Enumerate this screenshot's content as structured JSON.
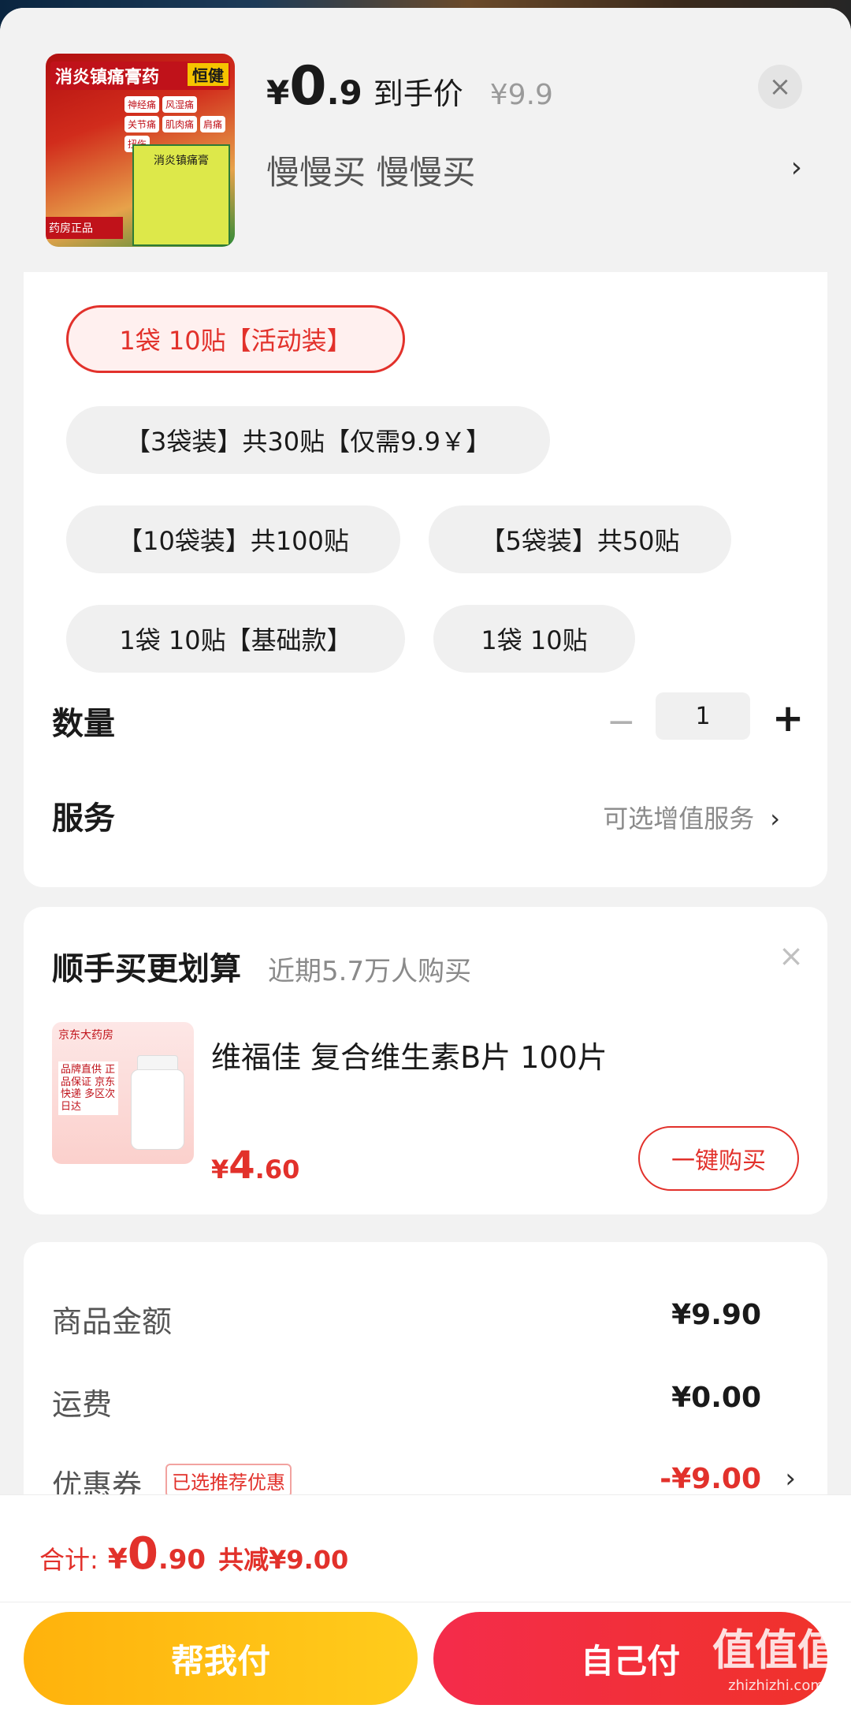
{
  "product": {
    "image_title": "消炎镇痛膏药",
    "image_brand": "恒健",
    "image_chips": [
      "神经痛",
      "风湿痛",
      "关节痛",
      "肌肉痛",
      "肩痛",
      "扭伤"
    ],
    "image_box_label": "消炎镇痛膏",
    "image_badge": "药房正品",
    "price_yen": "¥",
    "price_int": "0",
    "price_dec": ".9",
    "price_label": "到手价",
    "price_original": "¥9.9",
    "subtitle": "慢慢买  慢慢买",
    "close_icon": "×",
    "arrow": "›"
  },
  "variants": [
    {
      "label": "1袋 10贴【活动装】",
      "selected": true
    },
    {
      "label": "【3袋装】共30贴【仅需9.9￥】",
      "selected": false
    },
    {
      "label": "【10袋装】共100贴",
      "selected": false
    },
    {
      "label": "【5袋装】共50贴",
      "selected": false
    },
    {
      "label": "1袋 10贴【基础款】",
      "selected": false
    },
    {
      "label": "1袋  10贴",
      "selected": false
    }
  ],
  "quantity": {
    "label": "数量",
    "minus": "−",
    "value": "1",
    "plus": "+"
  },
  "service": {
    "label": "服务",
    "value": "可选增值服务",
    "arrow": "›"
  },
  "bundle": {
    "title": "顺手买更划算",
    "subtitle": "近期5.7万人购买",
    "close_icon": "×",
    "image_top": "京东大药房",
    "image_text": "品牌直供 正品保证 京东快递 多区次日达",
    "product_name": "维福佳 复合维生素B片 100片",
    "price_yen": "¥",
    "price_int": "4",
    "price_dec": ".60",
    "buy_label": "一键购买"
  },
  "summary": {
    "goods_label": "商品金额",
    "goods_value": "¥9.90",
    "shipping_label": "运费",
    "shipping_value": "¥0.00",
    "coupon_label": "优惠券",
    "coupon_tag": "已选推荐优惠",
    "coupon_value": "-¥9.00",
    "arrow": "›"
  },
  "footer": {
    "total_label": "合计:",
    "total_yen": "¥",
    "total_int": "0",
    "total_dec": ".90",
    "total_save": "共减¥9.00",
    "help_pay": "帮我付",
    "self_pay": "自己付",
    "watermark": "值值值",
    "watermark_sub": "zhizhizhi.com"
  },
  "colors": {
    "accent": "#e2312b",
    "help_btn": "#ffbd14",
    "self_btn": "#f22e3a"
  }
}
